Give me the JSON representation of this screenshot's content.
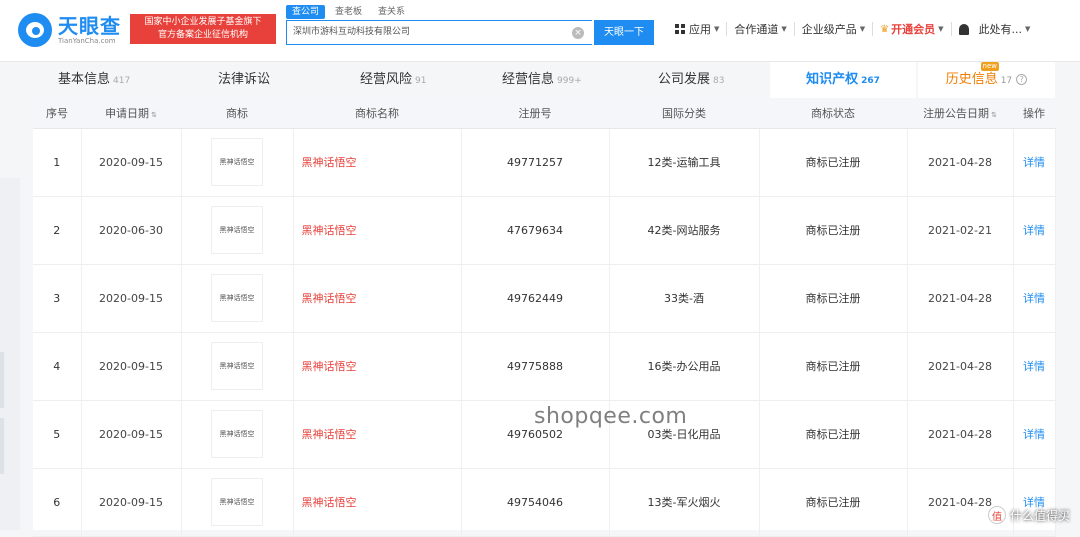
{
  "header": {
    "logo_title": "天眼查",
    "logo_sub": "TianYanCha.com",
    "promo_line1": "国家中小企业发展子基金旗下",
    "promo_line2": "官方备案企业征信机构",
    "search_tabs": [
      "查公司",
      "查老板",
      "查关系"
    ],
    "search_value": "深圳市游科互动科技有限公司",
    "search_button": "天眼一下",
    "nav": {
      "apps": "应用",
      "partners": "合作通道",
      "enterprise": "企业级产品",
      "vip": "开通会员",
      "user": "此处有..."
    }
  },
  "tabs": [
    {
      "label": "基本信息",
      "count": "417"
    },
    {
      "label": "法律诉讼",
      "count": ""
    },
    {
      "label": "经营风险",
      "count": "91"
    },
    {
      "label": "经营信息",
      "count": "999+"
    },
    {
      "label": "公司发展",
      "count": "83"
    },
    {
      "label": "知识产权",
      "count": "267"
    },
    {
      "label": "历史信息",
      "count": "17",
      "badge": "new"
    }
  ],
  "table": {
    "columns": [
      "序号",
      "申请日期",
      "商标",
      "商标名称",
      "注册号",
      "国际分类",
      "商标状态",
      "注册公告日期",
      "操作"
    ],
    "rows": [
      {
        "no": "1",
        "apply_date": "2020-09-15",
        "logo_text": "黑神话悟空",
        "name": "黑神话悟空",
        "reg_no": "49771257",
        "class": "12类-运输工具",
        "status": "商标已注册",
        "pub_date": "2021-04-28",
        "action": "详情"
      },
      {
        "no": "2",
        "apply_date": "2020-06-30",
        "logo_text": "黑神话悟空",
        "name": "黑神话悟空",
        "reg_no": "47679634",
        "class": "42类-网站服务",
        "status": "商标已注册",
        "pub_date": "2021-02-21",
        "action": "详情"
      },
      {
        "no": "3",
        "apply_date": "2020-09-15",
        "logo_text": "黑神话悟空",
        "name": "黑神话悟空",
        "reg_no": "49762449",
        "class": "33类-酒",
        "status": "商标已注册",
        "pub_date": "2021-04-28",
        "action": "详情"
      },
      {
        "no": "4",
        "apply_date": "2020-09-15",
        "logo_text": "黑神话悟空",
        "name": "黑神话悟空",
        "reg_no": "49775888",
        "class": "16类-办公用品",
        "status": "商标已注册",
        "pub_date": "2021-04-28",
        "action": "详情"
      },
      {
        "no": "5",
        "apply_date": "2020-09-15",
        "logo_text": "黑神话悟空",
        "name": "黑神话悟空",
        "reg_no": "49760502",
        "class": "03类-日化用品",
        "status": "商标已注册",
        "pub_date": "2021-04-28",
        "action": "详情"
      },
      {
        "no": "6",
        "apply_date": "2020-09-15",
        "logo_text": "黑神话悟空",
        "name": "黑神话悟空",
        "reg_no": "49754046",
        "class": "13类-军火烟火",
        "status": "商标已注册",
        "pub_date": "2021-04-28",
        "action": "详情"
      }
    ]
  },
  "watermark": "shopqee.com",
  "corner_watermark": "什么值得买",
  "colors": {
    "brand_blue": "#1e8cf0",
    "red": "#e8413b",
    "orange": "#f07c00"
  }
}
